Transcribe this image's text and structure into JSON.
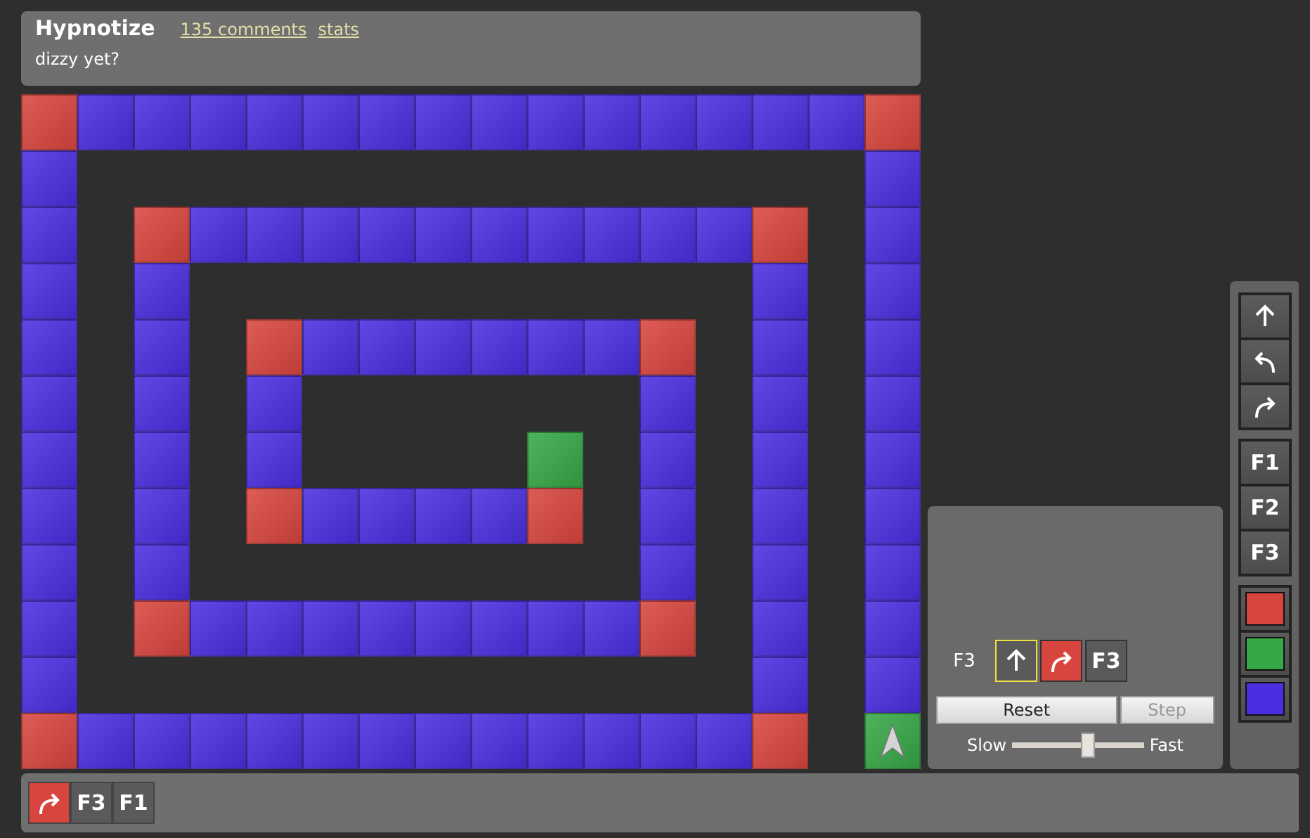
{
  "puzzle": {
    "title": "Hypnotize",
    "comments_link": "135 comments",
    "stats_link": "stats",
    "description": "dizzy yet?"
  },
  "board": {
    "rows": [
      [
        {
          "color": "#d8453e"
        },
        {
          "color": "#4a2fe0"
        },
        {
          "color": "#4a2fe0"
        },
        {
          "color": "#4a2fe0"
        },
        {
          "color": "#4a2fe0"
        },
        {
          "color": "#4a2fe0"
        },
        {
          "color": "#4a2fe0"
        },
        {
          "color": "#4a2fe0"
        },
        {
          "color": "#4a2fe0"
        },
        {
          "color": "#4a2fe0"
        },
        {
          "color": "#4a2fe0"
        },
        {
          "color": "#4a2fe0"
        },
        {
          "color": "#4a2fe0"
        },
        {
          "color": "#4a2fe0"
        },
        {
          "color": "#4a2fe0"
        },
        {
          "color": "#d8453e"
        }
      ],
      [
        {
          "color": "#4a2fe0"
        },
        null,
        null,
        null,
        null,
        null,
        null,
        null,
        null,
        null,
        null,
        null,
        null,
        null,
        null,
        {
          "color": "#4a2fe0"
        }
      ],
      [
        {
          "color": "#4a2fe0"
        },
        null,
        {
          "color": "#d8453e"
        },
        {
          "color": "#4a2fe0"
        },
        {
          "color": "#4a2fe0"
        },
        {
          "color": "#4a2fe0"
        },
        {
          "color": "#4a2fe0"
        },
        {
          "color": "#4a2fe0"
        },
        {
          "color": "#4a2fe0"
        },
        {
          "color": "#4a2fe0"
        },
        {
          "color": "#4a2fe0"
        },
        {
          "color": "#4a2fe0"
        },
        {
          "color": "#4a2fe0"
        },
        {
          "color": "#d8453e"
        },
        null,
        {
          "color": "#4a2fe0"
        }
      ],
      [
        {
          "color": "#4a2fe0"
        },
        null,
        {
          "color": "#4a2fe0"
        },
        null,
        null,
        null,
        null,
        null,
        null,
        null,
        null,
        null,
        null,
        {
          "color": "#4a2fe0"
        },
        null,
        {
          "color": "#4a2fe0"
        }
      ],
      [
        {
          "color": "#4a2fe0"
        },
        null,
        {
          "color": "#4a2fe0"
        },
        null,
        {
          "color": "#d8453e"
        },
        {
          "color": "#4a2fe0"
        },
        {
          "color": "#4a2fe0"
        },
        {
          "color": "#4a2fe0"
        },
        {
          "color": "#4a2fe0"
        },
        {
          "color": "#4a2fe0"
        },
        {
          "color": "#4a2fe0"
        },
        {
          "color": "#d8453e"
        },
        null,
        {
          "color": "#4a2fe0"
        },
        null,
        {
          "color": "#4a2fe0"
        }
      ],
      [
        {
          "color": "#4a2fe0"
        },
        null,
        {
          "color": "#4a2fe0"
        },
        null,
        {
          "color": "#4a2fe0"
        },
        null,
        null,
        null,
        null,
        null,
        null,
        {
          "color": "#4a2fe0"
        },
        null,
        {
          "color": "#4a2fe0"
        },
        null,
        {
          "color": "#4a2fe0"
        }
      ],
      [
        {
          "color": "#4a2fe0"
        },
        null,
        {
          "color": "#4a2fe0"
        },
        null,
        {
          "color": "#4a2fe0"
        },
        null,
        null,
        null,
        null,
        {
          "color": "#36a845"
        },
        null,
        {
          "color": "#4a2fe0"
        },
        null,
        {
          "color": "#4a2fe0"
        },
        null,
        {
          "color": "#4a2fe0"
        }
      ],
      [
        {
          "color": "#4a2fe0"
        },
        null,
        {
          "color": "#4a2fe0"
        },
        null,
        {
          "color": "#d8453e"
        },
        {
          "color": "#4a2fe0"
        },
        {
          "color": "#4a2fe0"
        },
        {
          "color": "#4a2fe0"
        },
        {
          "color": "#4a2fe0"
        },
        {
          "color": "#d8453e"
        },
        null,
        {
          "color": "#4a2fe0"
        },
        null,
        {
          "color": "#4a2fe0"
        },
        null,
        {
          "color": "#4a2fe0"
        }
      ],
      [
        {
          "color": "#4a2fe0"
        },
        null,
        {
          "color": "#4a2fe0"
        },
        null,
        null,
        null,
        null,
        null,
        null,
        null,
        null,
        {
          "color": "#4a2fe0"
        },
        null,
        {
          "color": "#4a2fe0"
        },
        null,
        {
          "color": "#4a2fe0"
        }
      ],
      [
        {
          "color": "#4a2fe0"
        },
        null,
        {
          "color": "#d8453e"
        },
        {
          "color": "#4a2fe0"
        },
        {
          "color": "#4a2fe0"
        },
        {
          "color": "#4a2fe0"
        },
        {
          "color": "#4a2fe0"
        },
        {
          "color": "#4a2fe0"
        },
        {
          "color": "#4a2fe0"
        },
        {
          "color": "#4a2fe0"
        },
        {
          "color": "#4a2fe0"
        },
        {
          "color": "#d8453e"
        },
        null,
        {
          "color": "#4a2fe0"
        },
        null,
        {
          "color": "#4a2fe0"
        }
      ],
      [
        {
          "color": "#4a2fe0"
        },
        null,
        null,
        null,
        null,
        null,
        null,
        null,
        null,
        null,
        null,
        null,
        null,
        {
          "color": "#4a2fe0"
        },
        null,
        {
          "color": "#4a2fe0"
        }
      ],
      [
        {
          "color": "#d8453e"
        },
        {
          "color": "#4a2fe0"
        },
        {
          "color": "#4a2fe0"
        },
        {
          "color": "#4a2fe0"
        },
        {
          "color": "#4a2fe0"
        },
        {
          "color": "#4a2fe0"
        },
        {
          "color": "#4a2fe0"
        },
        {
          "color": "#4a2fe0"
        },
        {
          "color": "#4a2fe0"
        },
        {
          "color": "#4a2fe0"
        },
        {
          "color": "#4a2fe0"
        },
        {
          "color": "#4a2fe0"
        },
        {
          "color": "#4a2fe0"
        },
        {
          "color": "#d8453e"
        },
        null,
        {
          "color": "#36a845",
          "kind": "robot"
        }
      ]
    ]
  },
  "program": {
    "functions": [
      {
        "label": "F3",
        "slots": [
          {
            "kind": "forward",
            "selected": true
          },
          {
            "kind": "right",
            "color": "#d8453e",
            "selected": false
          },
          {
            "kind": "call",
            "label": "F3",
            "selected": false
          }
        ]
      }
    ],
    "buttons": [
      {
        "label": "Reset",
        "disabled": false
      },
      {
        "label": "Step",
        "disabled": true
      }
    ],
    "speed": {
      "slow_label": "Slow",
      "fast_label": "Fast",
      "level": 0.58
    }
  },
  "palette": [
    [
      {
        "kind": "forward"
      },
      {
        "kind": "left"
      },
      {
        "kind": "right"
      }
    ],
    [
      {
        "kind": "call",
        "label": "F1"
      },
      {
        "kind": "call",
        "label": "F2"
      },
      {
        "kind": "call",
        "label": "F3"
      }
    ],
    [
      {
        "kind": "paint",
        "color": "#d8453e"
      },
      {
        "kind": "paint",
        "color": "#36a845"
      },
      {
        "kind": "paint",
        "color": "#4a2fe0"
      }
    ]
  ],
  "stack": [
    {
      "kind": "right",
      "color": "#d8453e"
    },
    {
      "kind": "call",
      "label": "F3"
    },
    {
      "kind": "call",
      "label": "F1"
    }
  ]
}
